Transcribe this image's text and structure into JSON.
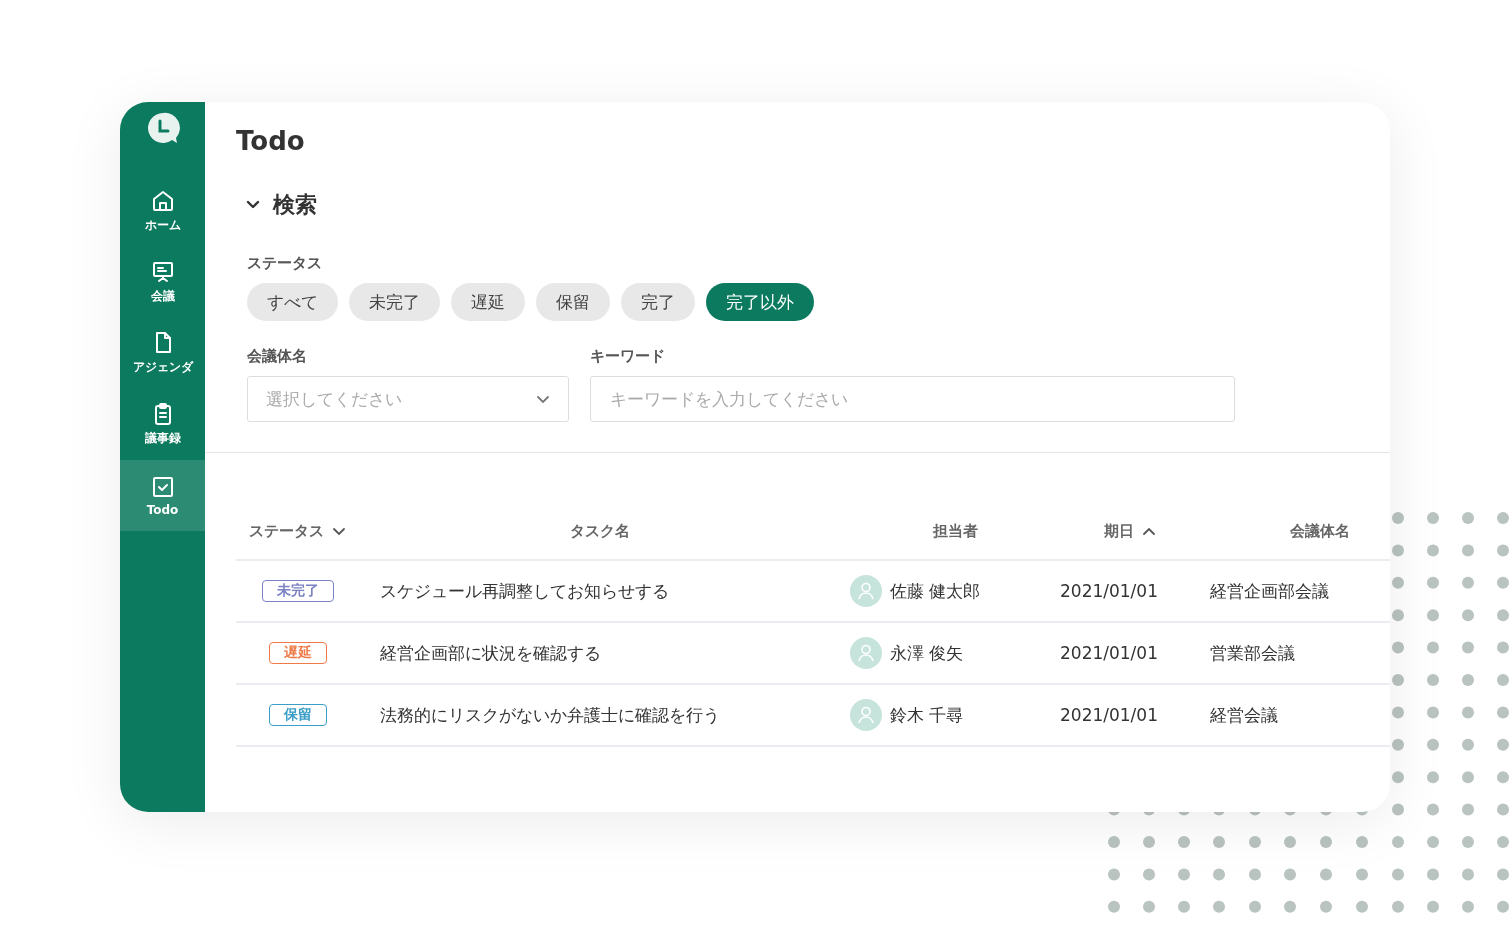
{
  "sidebar": {
    "items": [
      {
        "label": "ホーム",
        "kind": "home",
        "selected": false
      },
      {
        "label": "会議",
        "kind": "meeting",
        "selected": false
      },
      {
        "label": "アジェンダ",
        "kind": "document",
        "selected": false
      },
      {
        "label": "議事録",
        "kind": "clipboard",
        "selected": false
      },
      {
        "label": "Todo",
        "kind": "check",
        "selected": true
      }
    ]
  },
  "page_title": "Todo",
  "search": {
    "title": "検索",
    "expanded": true,
    "status_label": "ステータス",
    "status_filters": [
      {
        "label": "すべて",
        "selected": false
      },
      {
        "label": "未完了",
        "selected": false
      },
      {
        "label": "遅延",
        "selected": false
      },
      {
        "label": "保留",
        "selected": false
      },
      {
        "label": "完了",
        "selected": false
      },
      {
        "label": "完了以外",
        "selected": true
      }
    ],
    "meeting_label": "会議体名",
    "meeting_select": {
      "placeholder": "選択してください"
    },
    "keyword_label": "キーワード",
    "keyword_field": {
      "placeholder": "キーワードを入力してください"
    }
  },
  "table": {
    "columns": [
      {
        "label": "ステータス",
        "sorted": true,
        "ascending": false
      },
      {
        "label": "タスク名"
      },
      {
        "label": "担当者"
      },
      {
        "label": "期日",
        "sorted": true,
        "ascending": true
      },
      {
        "label": "会議体名"
      }
    ],
    "rows": [
      {
        "status": {
          "label": "未完了",
          "color": "#7b83c4"
        },
        "task": "スケジュール再調整してお知らせする",
        "assignee": "佐藤 健太郎",
        "due": "2021/01/01",
        "meeting": "経営企画部会議"
      },
      {
        "status": {
          "label": "遅延",
          "color": "#ef7a47"
        },
        "task": "経営企画部に状況を確認する",
        "assignee": "永澤 俊矢",
        "due": "2021/01/01",
        "meeting": "営業部会議"
      },
      {
        "status": {
          "label": "保留",
          "color": "#3a9ec6"
        },
        "task": "法務的にリスクがないか弁護士に確認を行う",
        "assignee": "鈴木 千尋",
        "due": "2021/01/01",
        "meeting": "経営会議"
      }
    ]
  }
}
